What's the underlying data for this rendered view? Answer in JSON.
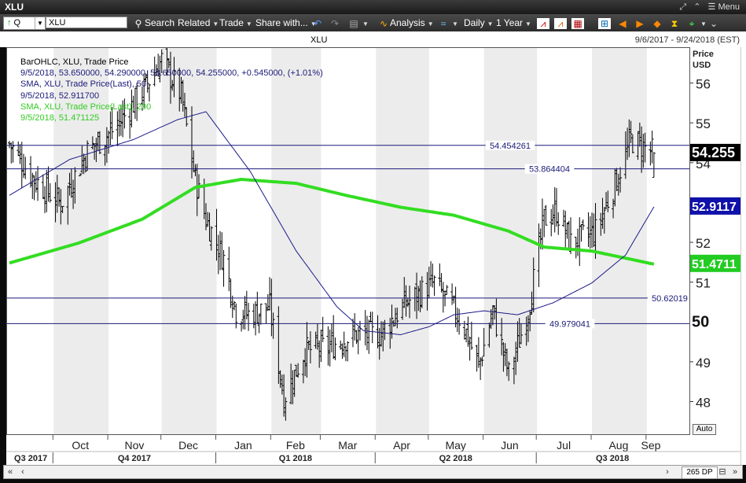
{
  "window": {
    "title": "XLU",
    "menu_label": "Menu"
  },
  "toolbar": {
    "symbol_type": "Q",
    "symbol_value": "XLU",
    "search": "Search",
    "related": "Related",
    "trade": "Trade",
    "share": "Share with...",
    "analysis": "Analysis",
    "period": "Daily",
    "span": "1 Year"
  },
  "header": {
    "symbol": "XLU",
    "date_range": "9/6/2017 - 9/24/2018 (EST)"
  },
  "colors": {
    "price_bar": "#000000",
    "sma50": "#1a1a8a",
    "sma200": "#33dd22",
    "hline": "#1a1a7a",
    "last_price_bg": "#000000",
    "sma50_bg": "#1010aa",
    "sma200_bg": "#22cc22"
  },
  "legend": {
    "line1": "BarOHLC, XLU, Trade Price",
    "line2": "9/5/2018, 53.650000, 54.290000, 53.650000, 54.255000, +0.545000, (+1.01%)",
    "line3": "SMA, XLU, Trade Price(Last), 50",
    "line4": "9/5/2018, 52.911700",
    "line5": "SMA, XLU, Trade Price(Last), 200",
    "line6": "9/5/2018, 51.471125"
  },
  "price_axis": {
    "title_line1": "Price",
    "title_line2": "USD",
    "auto_label": "Auto"
  },
  "scrollbar": {
    "dp_label": "265 DP"
  },
  "chart_data": {
    "type": "bar",
    "subtype": "ohlc",
    "ylim": [
      47.2,
      56.9
    ],
    "yticks": [
      48,
      49,
      50,
      51,
      52,
      53,
      54,
      55,
      56
    ],
    "months": [
      "Oct",
      "Nov",
      "Dec",
      "Jan",
      "Feb",
      "Mar",
      "Apr",
      "May",
      "Jun",
      "Jul",
      "Aug",
      "Sep"
    ],
    "quarters": [
      "Q3 2017",
      "Q4 2017",
      "Q1 2018",
      "Q2 2018",
      "Q3 2018"
    ],
    "horizontal_lines": [
      {
        "value": 54.454261,
        "label": "54.454261"
      },
      {
        "value": 53.864404,
        "label": "53.864404"
      },
      {
        "value": 50.62019,
        "label": "50.62019"
      },
      {
        "value": 49.979041,
        "label": "49.979041"
      }
    ],
    "price_labels": [
      {
        "label": "54.255",
        "value": 54.255,
        "kind": "last"
      },
      {
        "label": "52.9117",
        "value": 52.9117,
        "kind": "sma50"
      },
      {
        "label": "51.4711",
        "value": 51.4711,
        "kind": "sma200"
      },
      {
        "label": "50",
        "value": 50.0,
        "kind": "level"
      }
    ],
    "close_anchors": [
      {
        "date": "2017-09-06",
        "close": 54.5
      },
      {
        "date": "2017-09-20",
        "close": 53.6
      },
      {
        "date": "2017-10-05",
        "close": 53.0
      },
      {
        "date": "2017-10-20",
        "close": 54.3
      },
      {
        "date": "2017-11-05",
        "close": 54.9
      },
      {
        "date": "2017-11-20",
        "close": 55.8
      },
      {
        "date": "2017-12-01",
        "close": 56.6
      },
      {
        "date": "2017-12-12",
        "close": 55.7
      },
      {
        "date": "2017-12-20",
        "close": 53.6
      },
      {
        "date": "2017-12-26",
        "close": 52.6
      },
      {
        "date": "2018-01-05",
        "close": 51.6
      },
      {
        "date": "2018-01-12",
        "close": 50.3
      },
      {
        "date": "2018-01-20",
        "close": 50.2
      },
      {
        "date": "2018-01-31",
        "close": 50.4
      },
      {
        "date": "2018-02-08",
        "close": 48.1
      },
      {
        "date": "2018-02-20",
        "close": 49.3
      },
      {
        "date": "2018-03-05",
        "close": 49.4
      },
      {
        "date": "2018-03-20",
        "close": 49.7
      },
      {
        "date": "2018-04-03",
        "close": 49.7
      },
      {
        "date": "2018-04-18",
        "close": 50.5
      },
      {
        "date": "2018-05-04",
        "close": 51.0
      },
      {
        "date": "2018-05-20",
        "close": 50.0
      },
      {
        "date": "2018-05-29",
        "close": 48.9
      },
      {
        "date": "2018-06-06",
        "close": 50.3
      },
      {
        "date": "2018-06-15",
        "close": 48.7
      },
      {
        "date": "2018-06-26",
        "close": 50.3
      },
      {
        "date": "2018-07-05",
        "close": 52.6
      },
      {
        "date": "2018-07-12",
        "close": 52.8
      },
      {
        "date": "2018-07-20",
        "close": 52.0
      },
      {
        "date": "2018-08-03",
        "close": 52.3
      },
      {
        "date": "2018-08-15",
        "close": 53.6
      },
      {
        "date": "2018-08-23",
        "close": 54.6
      },
      {
        "date": "2018-09-05",
        "close": 54.255
      }
    ],
    "sma50_points": [
      {
        "date": "2017-09-06",
        "value": 53.2
      },
      {
        "date": "2017-10-10",
        "value": 54.1
      },
      {
        "date": "2017-11-15",
        "value": 54.6
      },
      {
        "date": "2017-12-10",
        "value": 55.1
      },
      {
        "date": "2017-12-26",
        "value": 55.3
      },
      {
        "date": "2018-01-20",
        "value": 53.8
      },
      {
        "date": "2018-02-15",
        "value": 51.8
      },
      {
        "date": "2018-03-10",
        "value": 50.4
      },
      {
        "date": "2018-03-25",
        "value": 49.8
      },
      {
        "date": "2018-04-15",
        "value": 49.7
      },
      {
        "date": "2018-05-01",
        "value": 49.9
      },
      {
        "date": "2018-05-15",
        "value": 50.2
      },
      {
        "date": "2018-06-01",
        "value": 50.3
      },
      {
        "date": "2018-06-20",
        "value": 50.2
      },
      {
        "date": "2018-07-10",
        "value": 50.5
      },
      {
        "date": "2018-08-01",
        "value": 51.0
      },
      {
        "date": "2018-08-20",
        "value": 51.7
      },
      {
        "date": "2018-09-05",
        "value": 52.9117
      }
    ],
    "sma200_points": [
      {
        "date": "2017-09-06",
        "value": 51.5
      },
      {
        "date": "2017-10-15",
        "value": 52.0
      },
      {
        "date": "2017-11-20",
        "value": 52.6
      },
      {
        "date": "2017-12-20",
        "value": 53.4
      },
      {
        "date": "2018-01-15",
        "value": 53.6
      },
      {
        "date": "2018-02-15",
        "value": 53.5
      },
      {
        "date": "2018-03-15",
        "value": 53.2
      },
      {
        "date": "2018-04-15",
        "value": 52.9
      },
      {
        "date": "2018-05-15",
        "value": 52.7
      },
      {
        "date": "2018-06-15",
        "value": 52.3
      },
      {
        "date": "2018-07-05",
        "value": 51.9
      },
      {
        "date": "2018-08-01",
        "value": 51.8
      },
      {
        "date": "2018-09-05",
        "value": 51.4711
      }
    ],
    "last_value": 54.255
  }
}
